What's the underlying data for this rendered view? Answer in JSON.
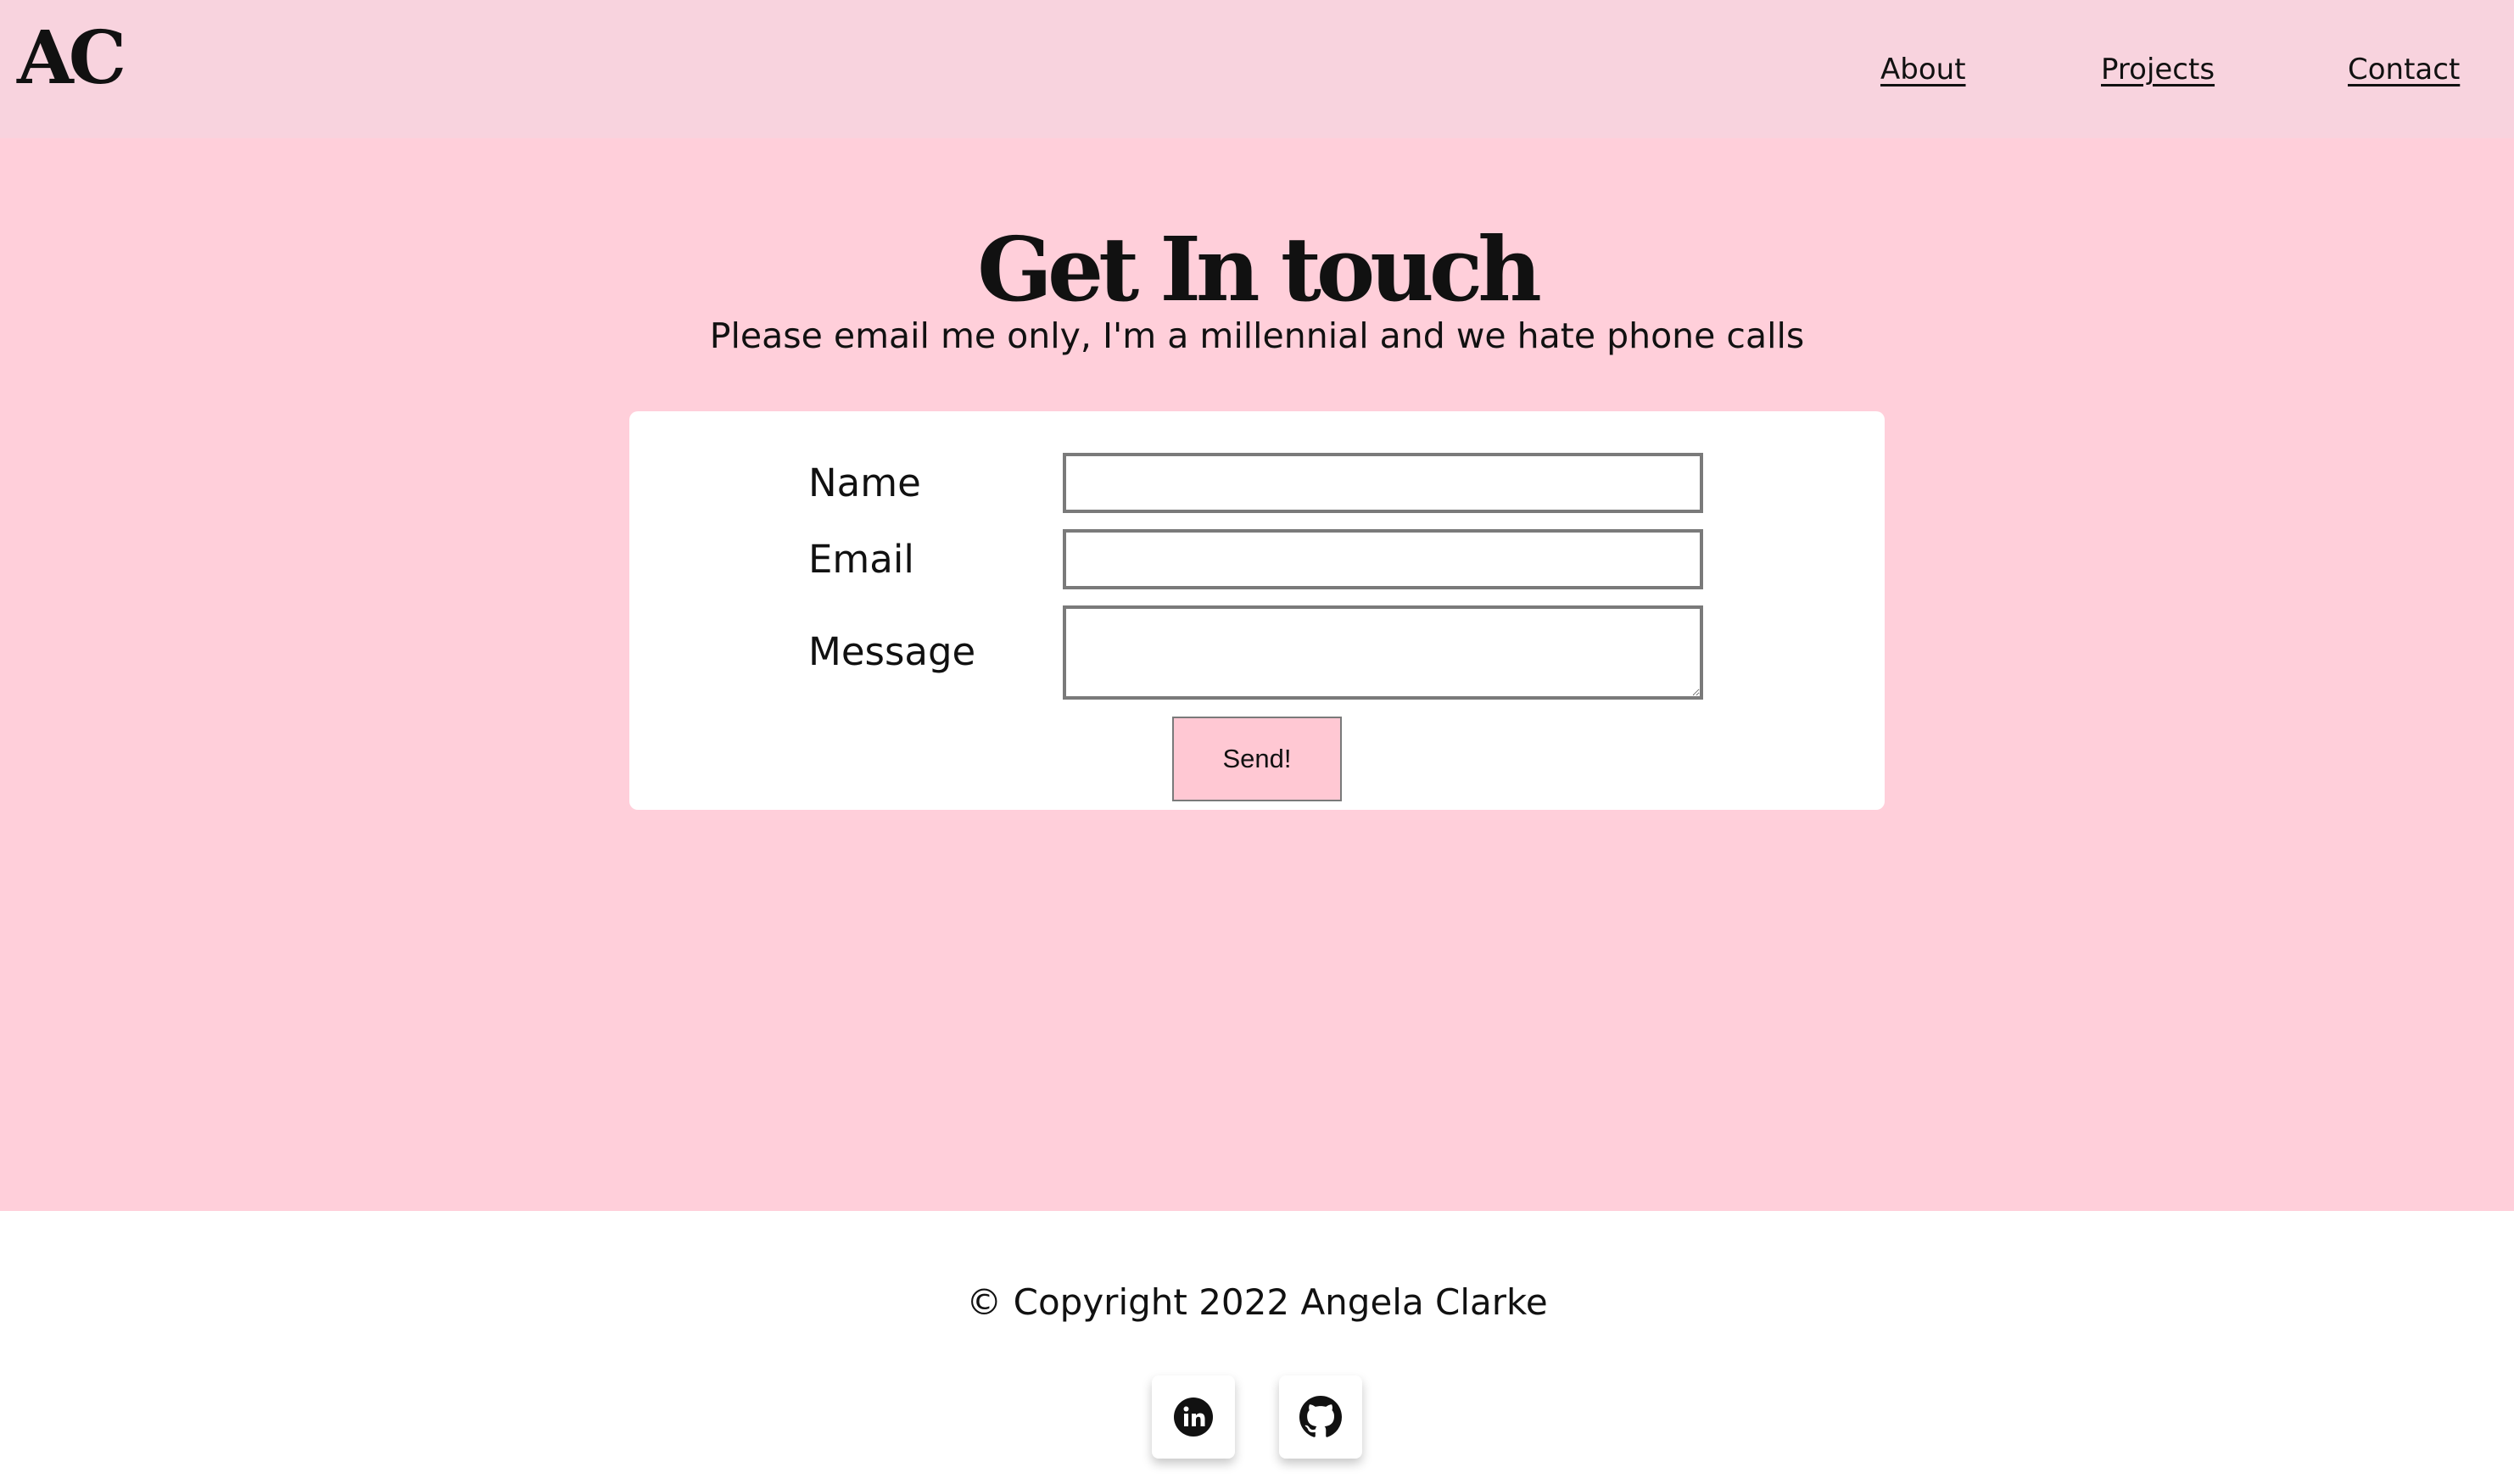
{
  "header": {
    "logo": "AC",
    "nav": {
      "about": "About",
      "projects": "Projects",
      "contact": "Contact"
    }
  },
  "main": {
    "title": "Get In touch",
    "subtitle": "Please email me only, I'm a millennial and we hate phone calls",
    "form": {
      "name_label": "Name",
      "email_label": "Email",
      "message_label": "Message",
      "name_value": "",
      "email_value": "",
      "message_value": "",
      "send_label": "Send!"
    }
  },
  "footer": {
    "copyright": "© Copyright 2022 Angela Clarke",
    "icons": [
      "linkedin-icon",
      "github-icon"
    ]
  },
  "colors": {
    "header_bg": "#f8d3de",
    "main_bg": "#ffcfda",
    "button_bg": "#ffc8d3",
    "card_bg": "#ffffff"
  }
}
